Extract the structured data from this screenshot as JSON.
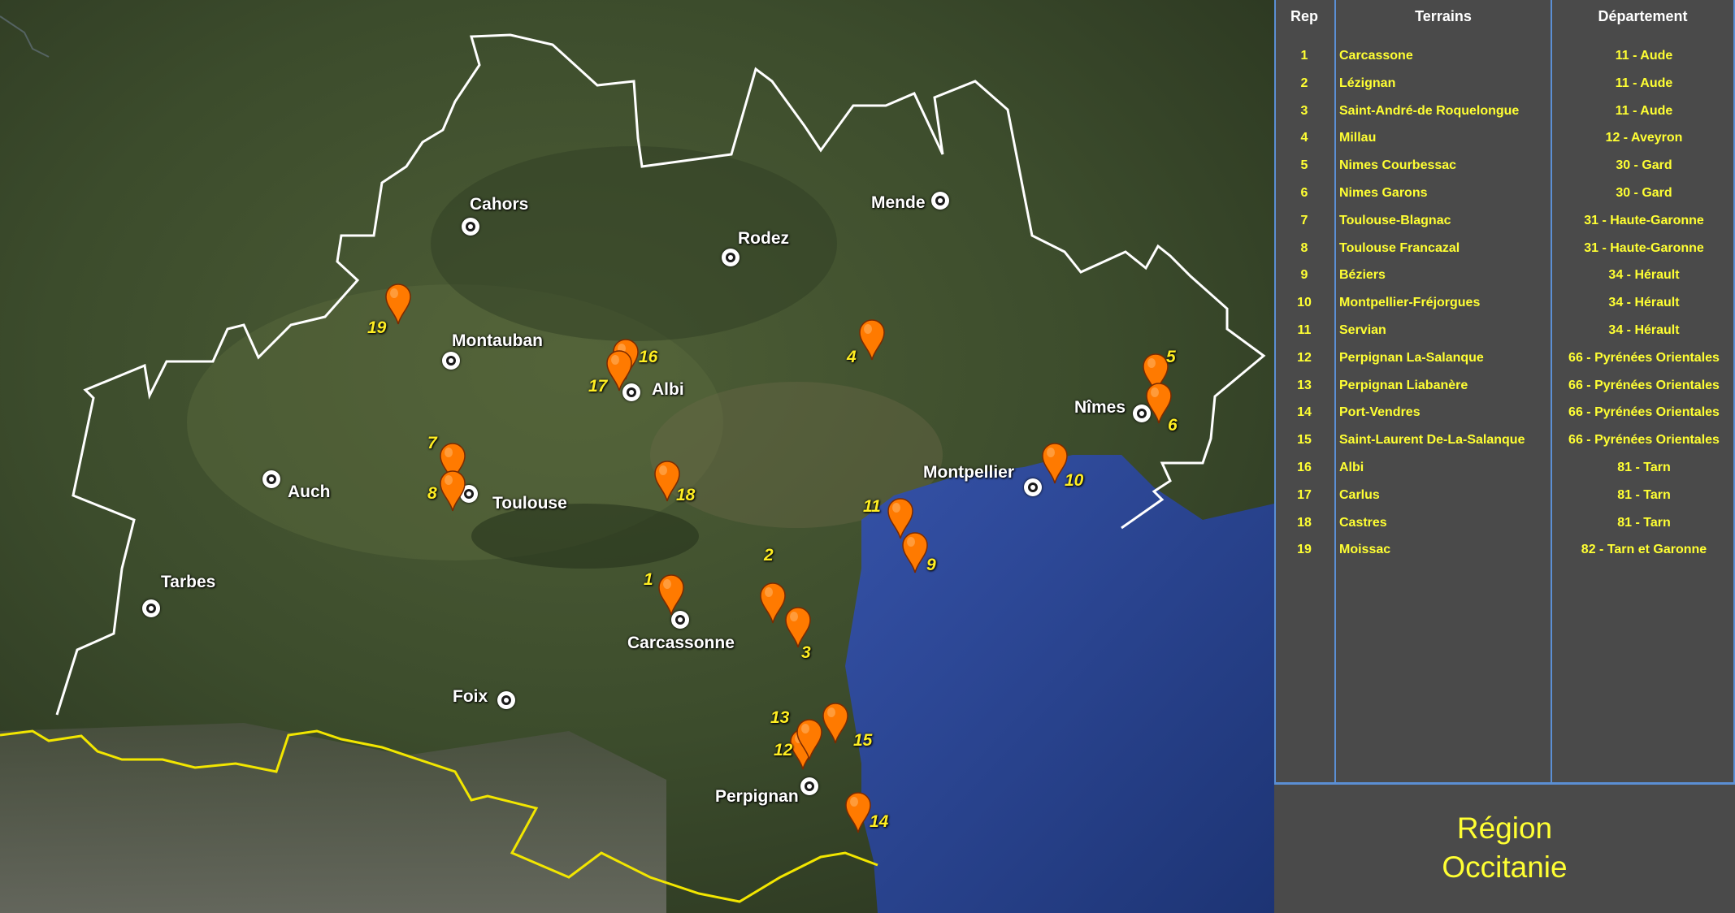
{
  "map": {
    "cities": [
      {
        "name": "Cahors"
      },
      {
        "name": "Rodez"
      },
      {
        "name": "Mende"
      },
      {
        "name": "Montauban"
      },
      {
        "name": "Albi"
      },
      {
        "name": "Nîmes"
      },
      {
        "name": "Auch"
      },
      {
        "name": "Toulouse"
      },
      {
        "name": "Montpellier"
      },
      {
        "name": "Tarbes"
      },
      {
        "name": "Carcassonne"
      },
      {
        "name": "Foix"
      },
      {
        "name": "Perpignan"
      }
    ],
    "markers": [
      "1",
      "2",
      "3",
      "4",
      "5",
      "6",
      "7",
      "8",
      "9",
      "10",
      "11",
      "12",
      "13",
      "14",
      "15",
      "16",
      "17",
      "18",
      "19"
    ],
    "colors": {
      "marker": "#ff7a00",
      "marker_label": "#ffee22",
      "region_border": "#ffffff",
      "national_border": "#f2e600",
      "sea": "#2a4a9a"
    }
  },
  "table": {
    "headers": {
      "rep": "Rep",
      "terrains": "Terrains",
      "departement": "Département"
    },
    "rows": [
      {
        "rep": "1",
        "terrain": "Carcassone",
        "dep": "11 - Aude"
      },
      {
        "rep": "2",
        "terrain": "Lézignan",
        "dep": "11 - Aude"
      },
      {
        "rep": "3",
        "terrain": "Saint-André-de Roquelongue",
        "dep": "11 - Aude"
      },
      {
        "rep": "4",
        "terrain": "Millau",
        "dep": "12 - Aveyron"
      },
      {
        "rep": "5",
        "terrain": "Nimes Courbessac",
        "dep": "30 - Gard"
      },
      {
        "rep": "6",
        "terrain": "Nimes Garons",
        "dep": "30 - Gard"
      },
      {
        "rep": "7",
        "terrain": "Toulouse-Blagnac",
        "dep": "31 - Haute-Garonne"
      },
      {
        "rep": "8",
        "terrain": "Toulouse Francazal",
        "dep": "31 - Haute-Garonne"
      },
      {
        "rep": "9",
        "terrain": "Béziers",
        "dep": "34 - Hérault"
      },
      {
        "rep": "10",
        "terrain": "Montpellier-Fréjorgues",
        "dep": "34 - Hérault"
      },
      {
        "rep": "11",
        "terrain": "Servian",
        "dep": "34 - Hérault"
      },
      {
        "rep": "12",
        "terrain": "Perpignan La-Salanque",
        "dep": "66 - Pyrénées Orientales"
      },
      {
        "rep": "13",
        "terrain": "Perpignan  Liabanère",
        "dep": "66 - Pyrénées Orientales"
      },
      {
        "rep": "14",
        "terrain": "Port-Vendres",
        "dep": "66 - Pyrénées Orientales"
      },
      {
        "rep": "15",
        "terrain": "Saint-Laurent De-La-Salanque",
        "dep": "66 - Pyrénées Orientales"
      },
      {
        "rep": "16",
        "terrain": "Albi",
        "dep": "81 - Tarn"
      },
      {
        "rep": "17",
        "terrain": "Carlus",
        "dep": "81 - Tarn"
      },
      {
        "rep": "18",
        "terrain": "Castres",
        "dep": "81 - Tarn"
      },
      {
        "rep": "19",
        "terrain": "Moissac",
        "dep": "82 - Tarn et Garonne"
      }
    ]
  },
  "region": {
    "line1": "Région",
    "line2": "Occitanie"
  }
}
